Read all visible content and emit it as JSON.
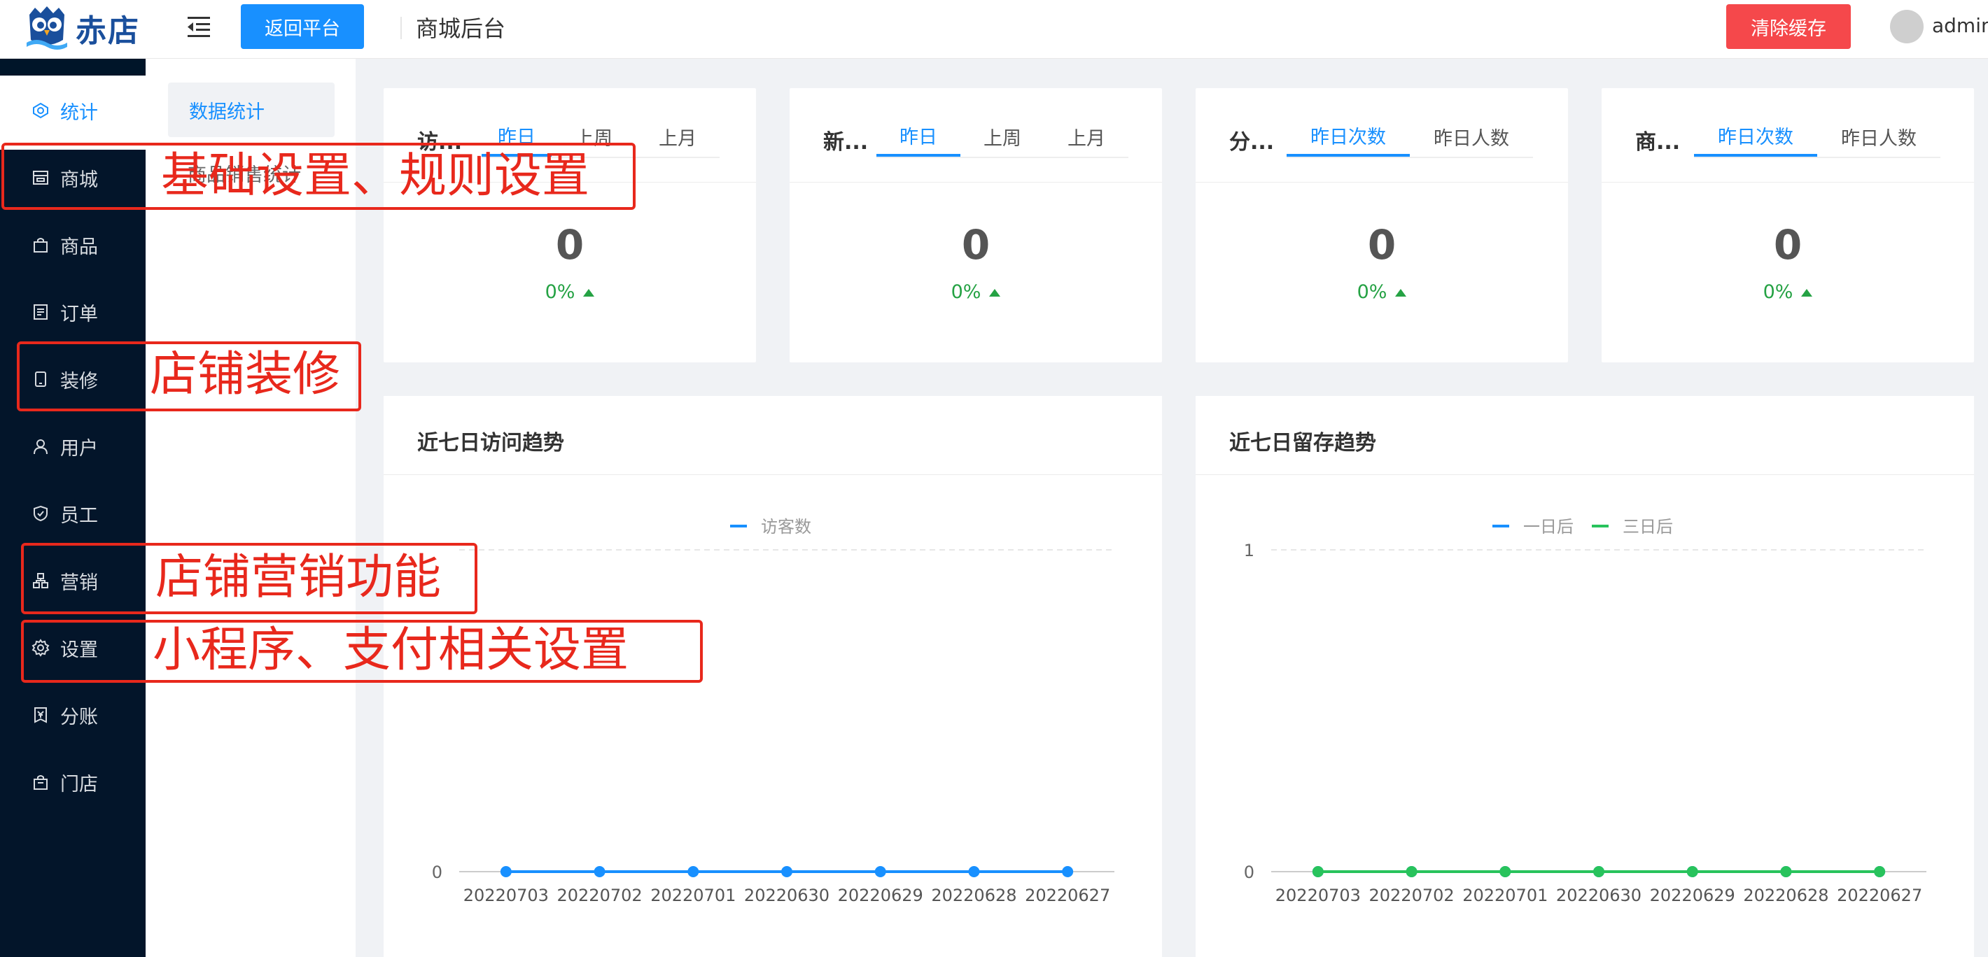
{
  "header": {
    "logo_text": "赤店",
    "back_label": "返回平台",
    "title": "商城后台",
    "clear_cache_label": "清除缓存",
    "user_name": "admin"
  },
  "sidebar": {
    "items": [
      {
        "label": "统计",
        "icon": "statistics-icon",
        "active": true
      },
      {
        "label": "商城",
        "icon": "store-icon"
      },
      {
        "label": "商品",
        "icon": "shopping-bag-icon"
      },
      {
        "label": "订单",
        "icon": "order-list-icon"
      },
      {
        "label": "装修",
        "icon": "tablet-icon"
      },
      {
        "label": "用户",
        "icon": "user-icon"
      },
      {
        "label": "员工",
        "icon": "shield-check-icon"
      },
      {
        "label": "营销",
        "icon": "network-icon"
      },
      {
        "label": "设置",
        "icon": "gear-icon"
      },
      {
        "label": "分账",
        "icon": "split-bill-icon"
      },
      {
        "label": "门店",
        "icon": "shop-bag-icon"
      }
    ]
  },
  "subpanel": {
    "active_item": "数据统计",
    "second_item": "商品销售统计"
  },
  "stat_cards": [
    {
      "title": "访...",
      "tabs": [
        "昨日",
        "上周",
        "上月"
      ],
      "value": "0",
      "pct": "0%"
    },
    {
      "title": "新...",
      "tabs": [
        "昨日",
        "上周",
        "上月"
      ],
      "value": "0",
      "pct": "0%"
    },
    {
      "title": "分...",
      "tabs": [
        "昨日次数",
        "昨日人数"
      ],
      "value": "0",
      "pct": "0%"
    },
    {
      "title": "商...",
      "tabs": [
        "昨日次数",
        "昨日人数"
      ],
      "value": "0",
      "pct": "0%"
    }
  ],
  "colors": {
    "primary": "#1890ff",
    "danger": "#f5484b",
    "sidebar_bg": "#03152a",
    "green": "#25a244",
    "annotation": "#e8281c"
  },
  "chart_data": [
    {
      "type": "line",
      "title": "近七日访问趋势",
      "categories": [
        "20220703",
        "20220702",
        "20220701",
        "20220630",
        "20220629",
        "20220628",
        "20220627"
      ],
      "series": [
        {
          "name": "访客数",
          "values": [
            0,
            0,
            0,
            0,
            0,
            0,
            0
          ],
          "color": "#1890ff"
        }
      ],
      "yticks": [
        "0"
      ],
      "ylim": [
        0,
        1
      ],
      "legend": "top-center",
      "grid": true
    },
    {
      "type": "line",
      "title": "近七日留存趋势",
      "categories": [
        "20220703",
        "20220702",
        "20220701",
        "20220630",
        "20220629",
        "20220628",
        "20220627"
      ],
      "series": [
        {
          "name": "一日后",
          "values": [
            0,
            0,
            0,
            0,
            0,
            0,
            0
          ],
          "color": "#1890ff"
        },
        {
          "name": "三日后",
          "values": [
            0,
            0,
            0,
            0,
            0,
            0,
            0
          ],
          "color": "#28c35c"
        }
      ],
      "yticks": [
        "0",
        "1"
      ],
      "ylim": [
        0,
        1
      ],
      "legend": "top-center",
      "grid": true
    }
  ],
  "annotations": [
    {
      "text": "基础设置、规则设置"
    },
    {
      "text": "店铺装修"
    },
    {
      "text": "店铺营销功能"
    },
    {
      "text": "小程序、支付相关设置"
    }
  ]
}
